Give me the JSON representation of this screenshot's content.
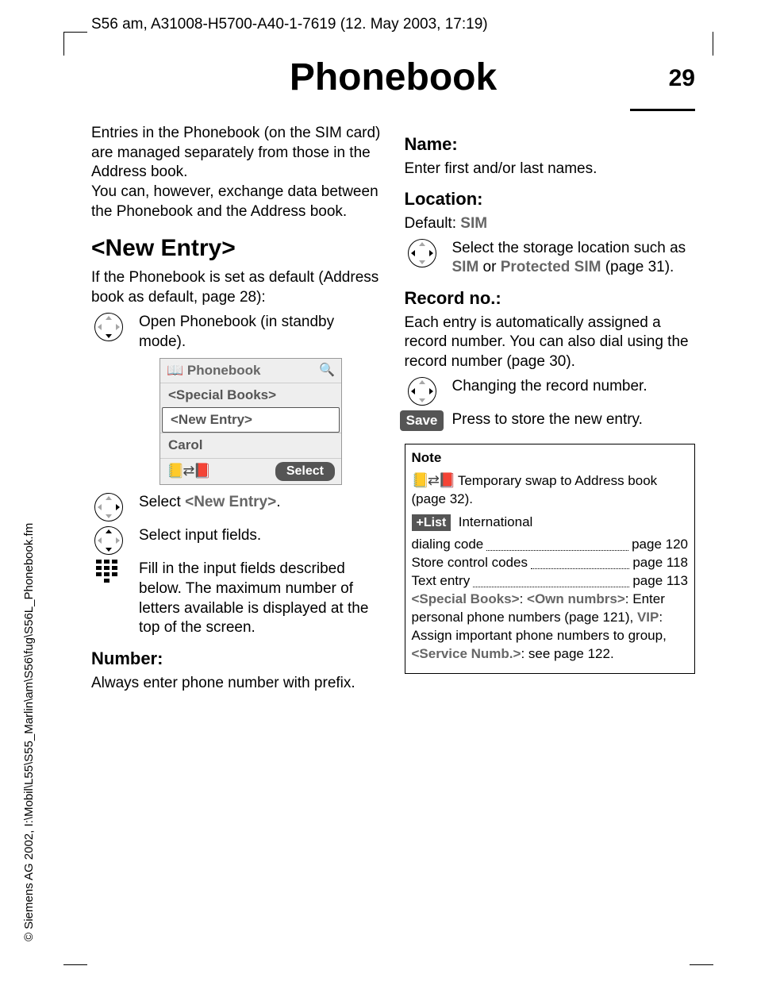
{
  "header": "S56 am, A31008-H5700-A40-1-7619 (12. May 2003, 17:19)",
  "side": "© Siemens AG 2002, I:\\Mobil\\L55\\S55_Marlin\\am\\S56\\fug\\S56L_Phonebook.fm",
  "title": "Phonebook",
  "page_number": "29",
  "left": {
    "intro": "Entries in the Phonebook (on the SIM card) are managed separately from those in the Address book.\nYou can, however, exchange data between the Phonebook and the Address book.",
    "h2": "<New Entry>",
    "after_h2": "If the Phonebook is set as default (Address book as default, page 28):",
    "open_pb": "Open Phonebook (in standby mode).",
    "screen": {
      "title": "Phonebook",
      "row1": "<Special Books>",
      "row2": "<New Entry>",
      "row3": "Carol",
      "softkey": "Select"
    },
    "sel_new": "Select ",
    "sel_new_em": "<New Entry>",
    "sel_new_tail": ".",
    "sel_input": "Select input fields.",
    "fill": "Fill in the input fields described below. The maximum number of letters available is displayed at the top of the screen.",
    "h3_number": "Number:",
    "number_text": "Always enter phone number with prefix."
  },
  "right": {
    "h3_name": "Name:",
    "name_text": "Enter first and/or last names.",
    "h3_location": "Location:",
    "loc_default_lbl": "Default: ",
    "loc_default_val": "SIM",
    "loc_text_a": "Select the storage location such as ",
    "loc_sim": "SIM",
    "loc_text_b": " or ",
    "loc_prot": "Protected SIM",
    "loc_text_c": " (page 31).",
    "h3_record": "Record no.:",
    "record_intro": "Each entry is automatically assigned a record number. You can also dial using the record number (page 30).",
    "change_rec": "Changing the record number.",
    "save_label": "Save",
    "save_text": "Press to store the new entry.",
    "note": {
      "title": "Note",
      "swap": " Temporary swap to Address book (page 32).",
      "list_label": "+List",
      "intl_a": "International",
      "intl_b": "dialing code",
      "intl_pg": "page 120",
      "store": "Store control codes",
      "store_pg": "page 118",
      "text_entry": "Text entry",
      "text_pg": "page 113",
      "sb": "<Special Books>",
      "own": "<Own numbrs>",
      "sb_text_a": ": ",
      "sb_text_b": ": Enter personal phone numbers (page 121), ",
      "vip": "VIP",
      "sb_text_c": ": Assign important phone numbers to group, ",
      "serv": "<Service Numb.>",
      "sb_text_d": ": see page 122."
    }
  }
}
